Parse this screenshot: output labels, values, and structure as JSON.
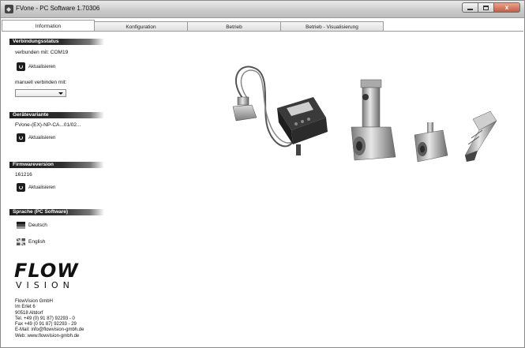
{
  "window": {
    "title": "FVone - PC Software 1.70306",
    "controls": {
      "minimize": "",
      "maximize": "",
      "close": "x"
    }
  },
  "tabs": [
    {
      "label": "Information"
    },
    {
      "label": "Konfiguration"
    },
    {
      "label": "Betrieb"
    },
    {
      "label": "Betrieb - Visualisierung"
    }
  ],
  "sidebar": {
    "connection": {
      "header": "Verbindungsstatus",
      "connected_text": "verbunden mit:  COM19",
      "refresh_label": "Aktualisieren",
      "manual_label": "manuell verbinden mit:",
      "port_value": ""
    },
    "device": {
      "header": "Gerätevariante",
      "variant": "FVone-(EX)-NP-CA...01/02...",
      "refresh_label": "Aktualisieren"
    },
    "firmware": {
      "header": "Firmwareversion",
      "version": "161216",
      "refresh_label": "Aktualisieren"
    },
    "language": {
      "header": "Sprache (PC Software)",
      "options": [
        {
          "label": "Deutsch"
        },
        {
          "label": "English"
        }
      ]
    }
  },
  "company": {
    "logo_main": "FLOW",
    "logo_sub": "VISION",
    "address_lines": [
      "FlowVision GmbH",
      "Im Erlet 6",
      "90518 Altdorf",
      "Tel. +49 (0) 91 87) 92293 - 0",
      "Fax +49 (0 91 87) 92293 - 29",
      "E-Mail: info@flowvision-gmbh.de",
      "Web: www.flowvision-gmbh.de"
    ]
  },
  "icons": {
    "app": "fvone-app-icon",
    "refresh": "refresh-icon",
    "flag_de": "german-flag-icon",
    "flag_en": "uk-flag-icon",
    "combo": "chevron-down-icon"
  }
}
